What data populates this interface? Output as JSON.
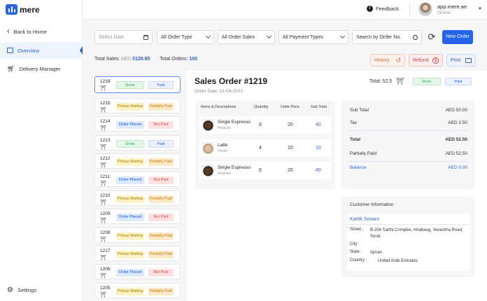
{
  "brand": {
    "name": "mere"
  },
  "nav": [
    {
      "label": "Back to Home",
      "icon": "chevron-left-icon"
    },
    {
      "label": "Overview",
      "icon": "overview-icon"
    },
    {
      "label": "Delivery Manager",
      "icon": "cart-icon"
    }
  ],
  "settings": {
    "label": "Settings"
  },
  "header": {
    "feedback": "Feedback",
    "user_url": "app.mere.ae",
    "user_status": "Online"
  },
  "filters": {
    "date_placeholder": "Select Date",
    "order_type": "All Order Type",
    "order_sales": "All Order Sales",
    "payment_types": "All Payment Types",
    "search_placeholder": "Search by Order No.",
    "new_order": "New Order"
  },
  "totals": {
    "sales_label": "Total Sales:",
    "sales_currency": "AED",
    "sales_value": "5129.85",
    "orders_label": "Total Orders:",
    "orders_value": "100"
  },
  "actions": {
    "history": "History",
    "refund": "Refund",
    "print": "Print"
  },
  "orders": [
    {
      "number": "1219",
      "status": "Done",
      "payment": "Paid"
    },
    {
      "number": "1215",
      "status": "Pickup Waiting",
      "payment": "Partially Paid"
    },
    {
      "number": "1214",
      "status": "Order Placed",
      "payment": "Not Paid"
    },
    {
      "number": "1213",
      "status": "Done",
      "payment": "Paid"
    },
    {
      "number": "1212",
      "status": "Pickup Waiting",
      "payment": "Partially Paid"
    },
    {
      "number": "1211",
      "status": "Order Placed",
      "payment": "Not Paid"
    },
    {
      "number": "1210",
      "status": "Pickup Waiting",
      "payment": "Partially Paid"
    },
    {
      "number": "1209",
      "status": "Order Placed",
      "payment": "Not Paid"
    },
    {
      "number": "1208",
      "status": "Pickup Waiting",
      "payment": "Partially Paid"
    },
    {
      "number": "1217",
      "status": "Pickup Waiting",
      "payment": "Partially Paid"
    },
    {
      "number": "1206",
      "status": "Order Placed",
      "payment": "Not Paid"
    },
    {
      "number": "1205",
      "status": "Pickup Waiting",
      "payment": "Partially Paid"
    }
  ],
  "order": {
    "title": "Sales Order #1219",
    "date": "Order Date: 21-04-2021",
    "total": "Total: 52.5",
    "status": "Done",
    "payment": "Paid",
    "headers": [
      "Items & Descriptions",
      "Quantity",
      "Unite Price",
      "Sub Total"
    ],
    "items": [
      {
        "name": "Single Espresso",
        "size": "Regular",
        "qty": "6",
        "price": "20",
        "sub": "40"
      },
      {
        "name": "Latte",
        "size": "Small",
        "qty": "4",
        "price": "10",
        "sub": "10"
      },
      {
        "name": "Single Espresso",
        "size": "Regular",
        "qty": "6",
        "price": "20",
        "sub": "40"
      }
    ],
    "summary": {
      "subtotal_label": "Sub Total",
      "subtotal": "AED 50.00",
      "tax_label": "Tax",
      "tax": "AED 2.50",
      "total_label": "Total",
      "total": "AED 52.50",
      "partial_label": "Partially Paid",
      "partial": "AED 52.50",
      "balance_label": "Balance",
      "balance": "AED 0.00"
    },
    "customer": {
      "title": "Customer Information",
      "name": "Kartik Sonani",
      "street_label": "Street :",
      "street": "B-204 Sarthi Complex, Hirabaug, Varachha Road, Surat.",
      "city_label": "City :",
      "city": "",
      "state_label": "State :",
      "state": "Ajman",
      "country_label": "Country :",
      "country": "United Arab Emirates"
    }
  },
  "colors": {
    "accent": "#2563eb",
    "done": "#2e9b4e",
    "not_paid": "#d04444",
    "waiting": "#a07a00"
  }
}
